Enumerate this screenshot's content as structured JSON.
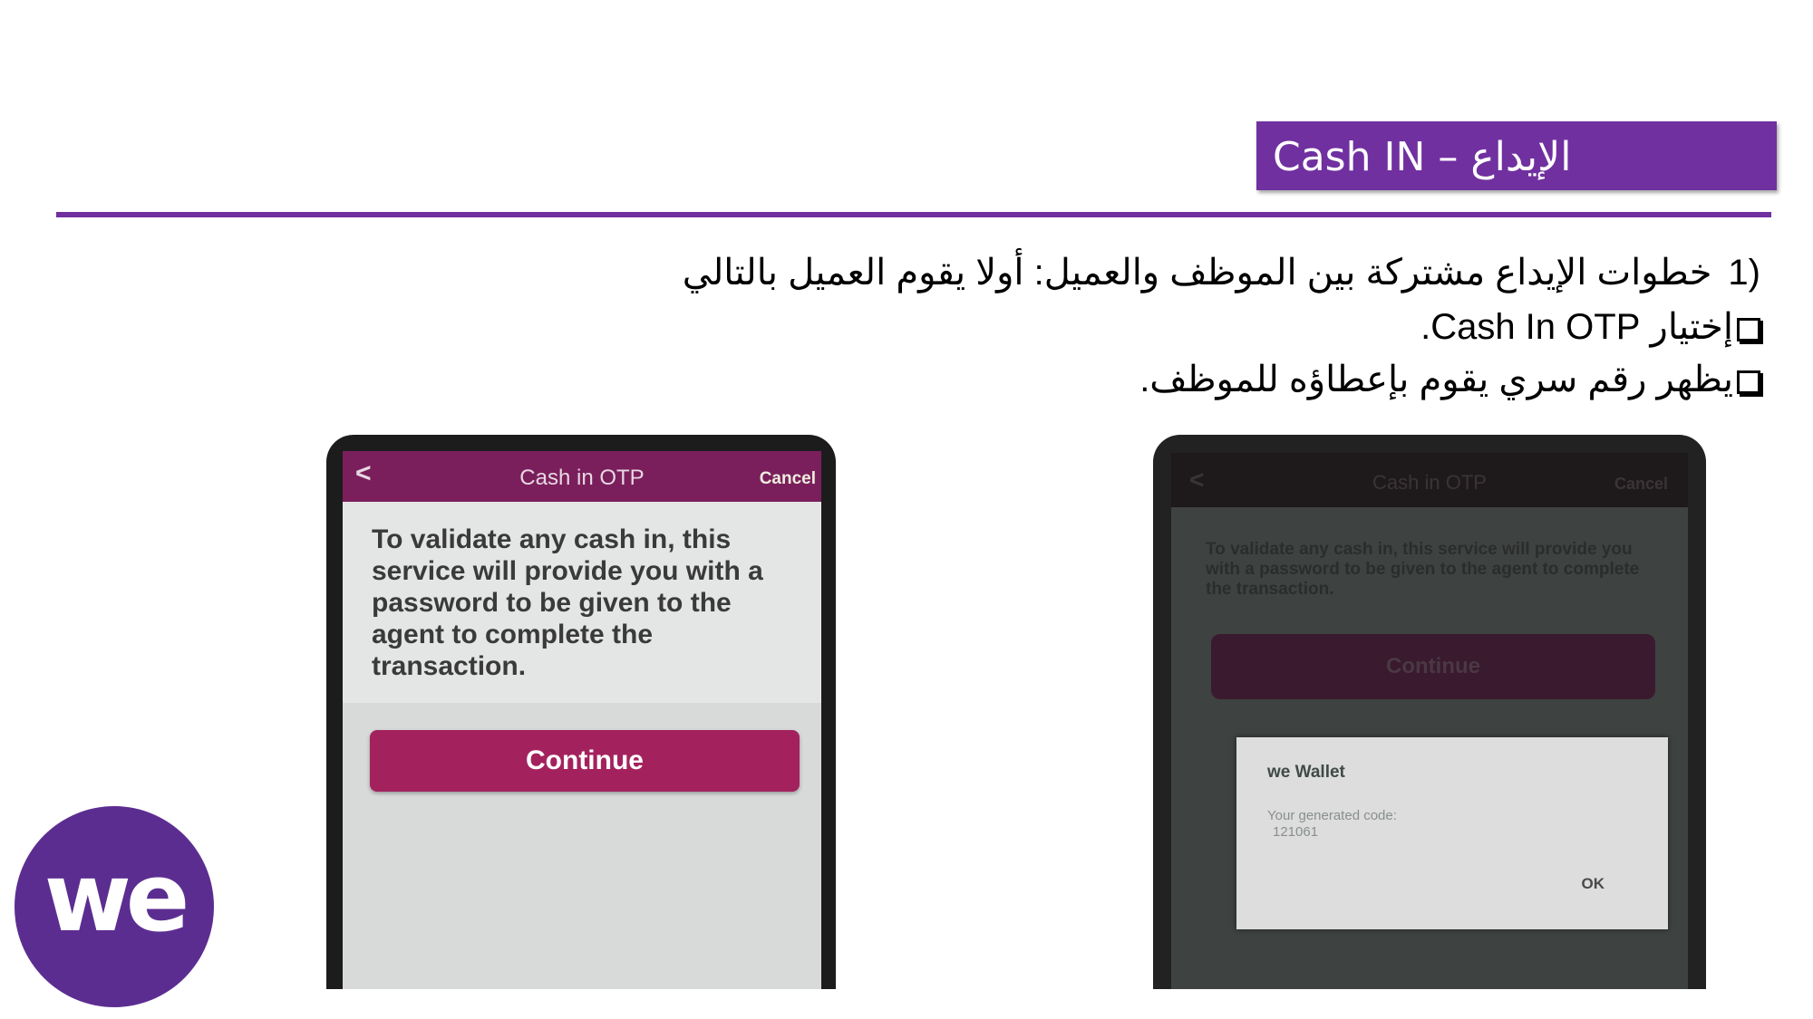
{
  "slide": {
    "title": "Cash IN – الإيداع",
    "step_number": "1)",
    "step_text": "خطوات الإيداع مشتركة بين الموظف والعميل: أولا يقوم العميل بالتالي",
    "bullet1": "إختيار Cash In OTP.",
    "bullet2": "يظهر رقم سري يقوم بإعطاؤه للموظف."
  },
  "phone1": {
    "back_icon": "<",
    "title": "Cash in OTP",
    "cancel": "Cancel",
    "message": "To validate any cash in, this service will provide you with a password to be given to the agent to complete the transaction.",
    "continue": "Continue"
  },
  "phone2": {
    "back_icon": "<",
    "title": "Cash in OTP",
    "cancel": "Cancel",
    "message": "To validate any cash in, this service will provide you with a password to be given to the agent to complete the transaction.",
    "continue": "Continue",
    "dialog": {
      "title": "we Wallet",
      "label": "Your generated code:",
      "code": "121061",
      "ok": "OK"
    }
  },
  "logo": {
    "text": "we"
  },
  "colors": {
    "accent": "#7030a0",
    "button": "#a3225e",
    "logo": "#5c2d91"
  }
}
